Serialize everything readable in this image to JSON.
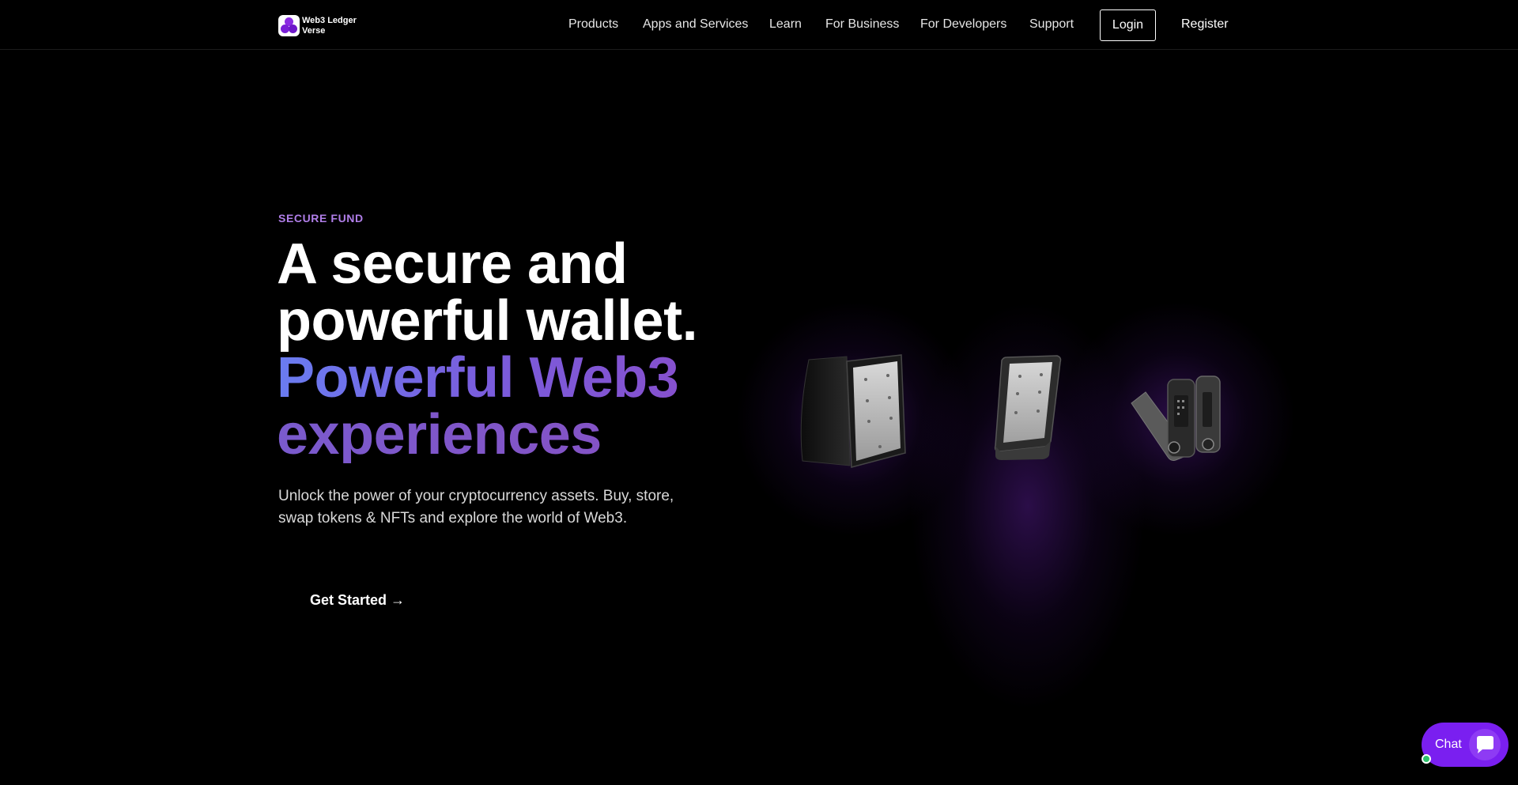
{
  "brand": {
    "name": "Web3 Ledger Verse",
    "accent_color": "#7a1ff0"
  },
  "nav": {
    "items": [
      {
        "label": "Products"
      },
      {
        "label": "Apps and Services"
      },
      {
        "label": "Learn"
      },
      {
        "label": "For Business"
      },
      {
        "label": "For Developers"
      },
      {
        "label": "Support"
      }
    ],
    "login_label": "Login",
    "register_label": "Register"
  },
  "hero": {
    "eyebrow": "SECURE FUND",
    "headline": {
      "line1": "A secure and",
      "line2": "powerful wallet.",
      "line3": "Powerful Web3",
      "line4": "experiences"
    },
    "subtitle": "Unlock the power of your cryptocurrency assets. Buy, store, swap tokens & NFTs and explore the world of Web3.",
    "cta_label": "Get Started →"
  },
  "devices": [
    "folio-wallet-device",
    "touchscreen-wallet-device",
    "usb-wallet-device"
  ],
  "chat": {
    "label": "Chat",
    "status_color": "#2ec26c"
  }
}
